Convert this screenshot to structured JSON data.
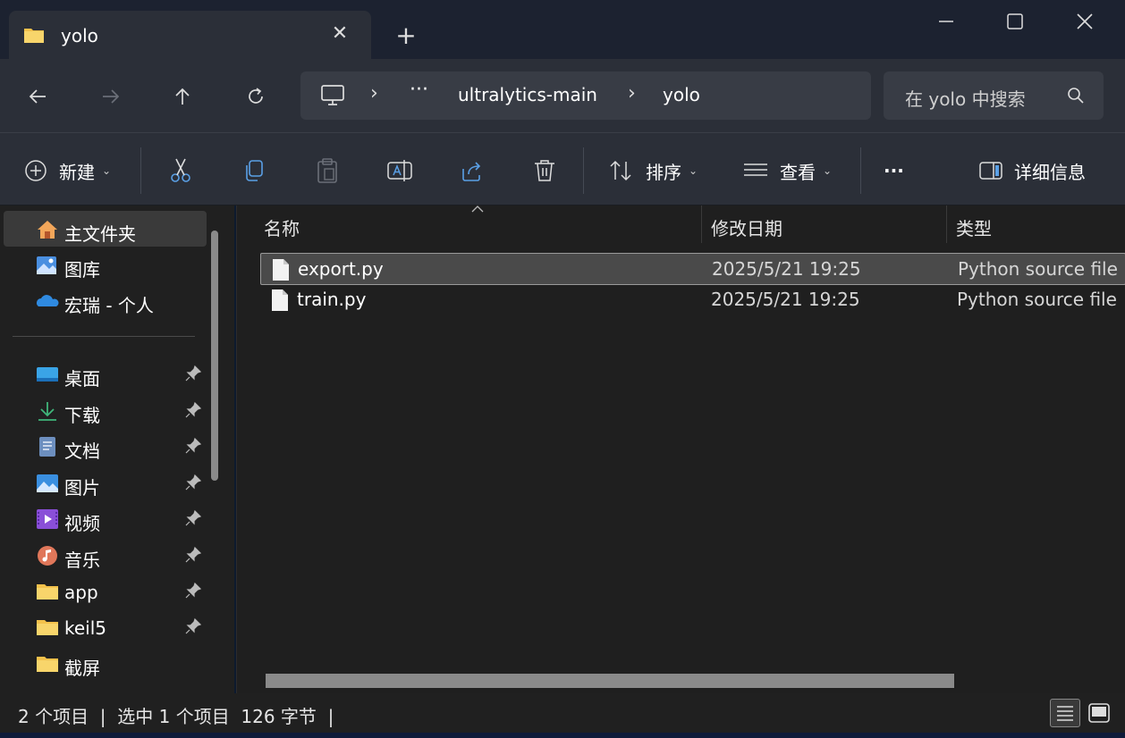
{
  "window": {
    "tab_title": "yolo",
    "tab_close": "✕",
    "new_tab": "+"
  },
  "address": {
    "overflow": "···",
    "segments": [
      "ultralytics-main",
      "yolo"
    ],
    "separator": "›",
    "search_placeholder": "在 yolo 中搜索"
  },
  "toolbar": {
    "new_label": "新建",
    "sort_label": "排序",
    "view_label": "查看",
    "more_label": "···",
    "details_label": "详细信息"
  },
  "sidebar": {
    "items": [
      {
        "label": "主文件夹",
        "icon": "home-icon"
      },
      {
        "label": "图库",
        "icon": "gallery-icon"
      },
      {
        "label": "宏瑞 - 个人",
        "icon": "onedrive-icon"
      },
      {
        "label": "桌面",
        "icon": "desktop-icon",
        "pinned": true
      },
      {
        "label": "下载",
        "icon": "download-icon",
        "pinned": true
      },
      {
        "label": "文档",
        "icon": "document-icon",
        "pinned": true
      },
      {
        "label": "图片",
        "icon": "pictures-icon",
        "pinned": true
      },
      {
        "label": "视频",
        "icon": "videos-icon",
        "pinned": true
      },
      {
        "label": "音乐",
        "icon": "music-icon",
        "pinned": true
      },
      {
        "label": "app",
        "icon": "folder-icon",
        "pinned": true
      },
      {
        "label": "keil5",
        "icon": "folder-icon",
        "pinned": true
      },
      {
        "label": "截屏",
        "icon": "folder-icon",
        "pinned": false
      }
    ]
  },
  "table": {
    "columns": [
      "名称",
      "修改日期",
      "类型"
    ],
    "rows": [
      {
        "name": "export.py",
        "date": "2025/5/21 19:25",
        "type": "Python source file",
        "selected": true
      },
      {
        "name": "train.py",
        "date": "2025/5/21 19:25",
        "type": "Python source file",
        "selected": false
      }
    ]
  },
  "status": {
    "text": "2 个项目  |  选中 1 个项目  126 字节  |"
  },
  "colors": {
    "titlebar": "#1c2230",
    "chrome": "#2b2f38",
    "content": "#1f1f1f",
    "selected_row": "#4a4a4a",
    "folder": "#f3c14b"
  }
}
